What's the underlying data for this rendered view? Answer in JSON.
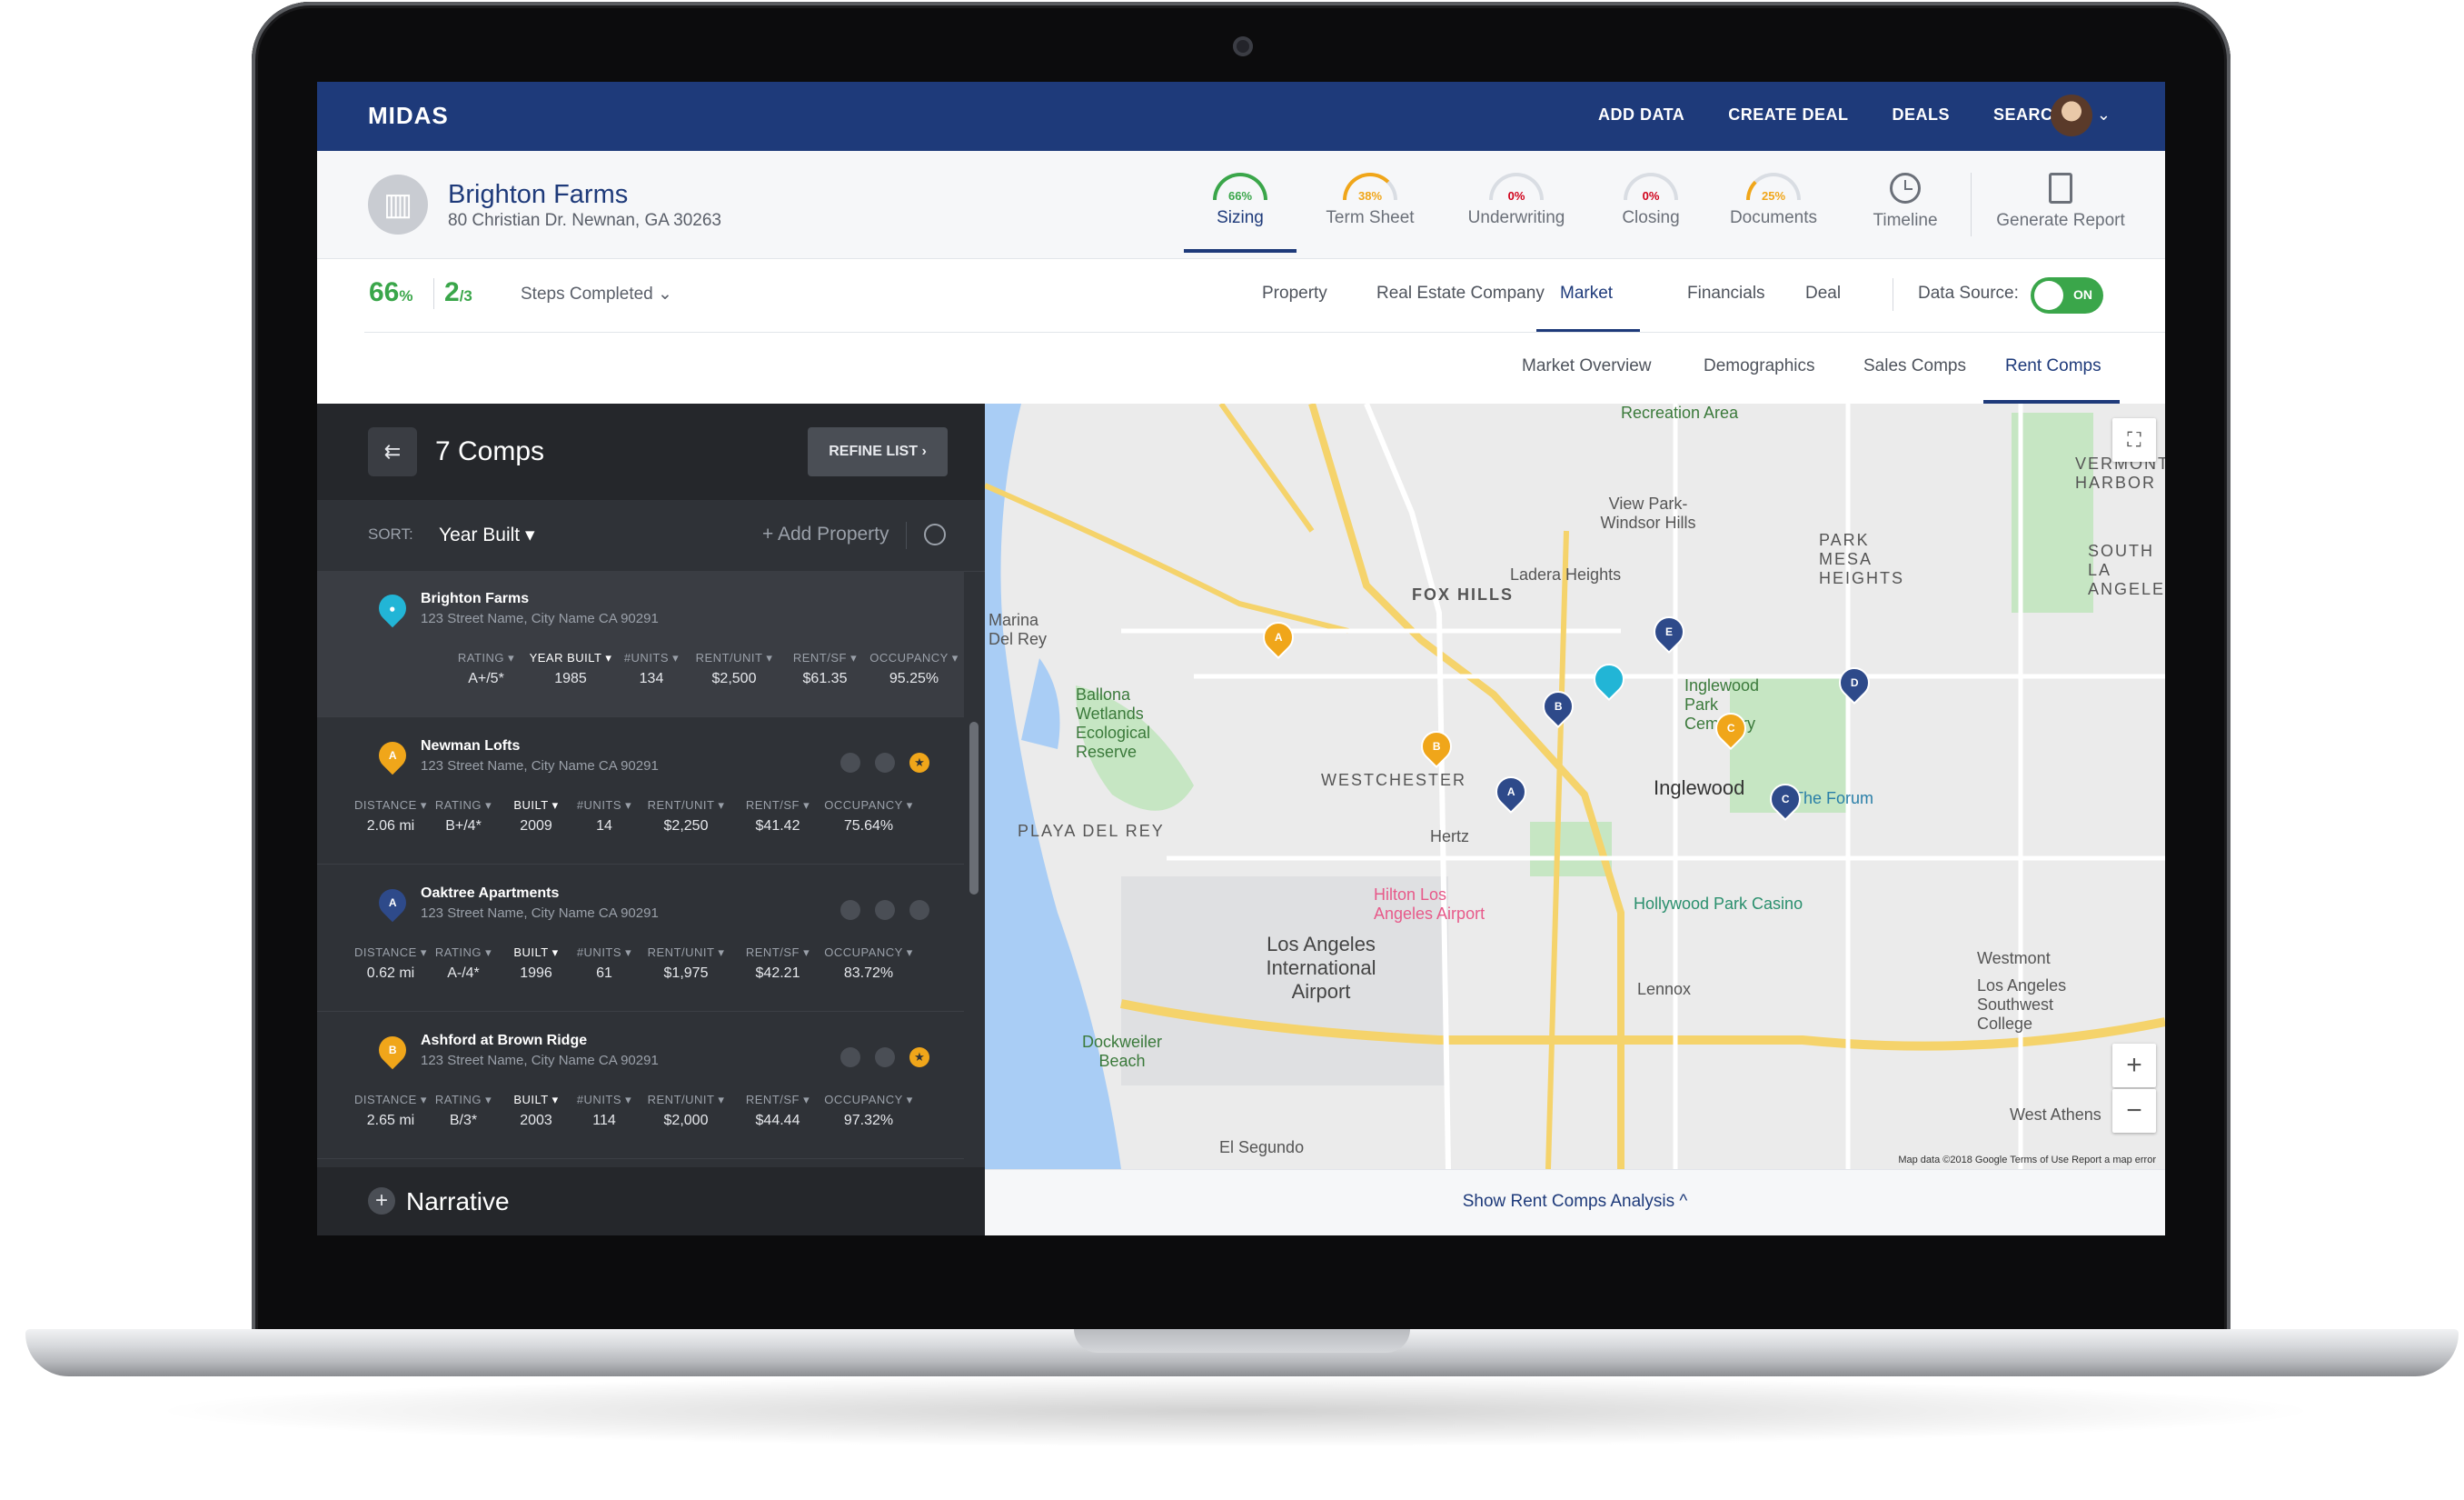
{
  "app": {
    "brand": "MIDAS",
    "nav": [
      "ADD DATA",
      "CREATE DEAL",
      "DEALS",
      "SEARCH"
    ]
  },
  "property": {
    "name": "Brighton Farms",
    "address": "80 Christian Dr. Newnan, GA 30263"
  },
  "workflow_steps": [
    {
      "label": "Sizing",
      "pct": "66%",
      "color": "#3aa64a",
      "progress": 0.66,
      "active": true
    },
    {
      "label": "Term Sheet",
      "pct": "38%",
      "color": "#f0a61a",
      "progress": 0.38
    },
    {
      "label": "Underwriting",
      "pct": "0%",
      "color": "#d0021b",
      "progress": 0.0
    },
    {
      "label": "Closing",
      "pct": "0%",
      "color": "#d0021b",
      "progress": 0.0
    },
    {
      "label": "Documents",
      "pct": "25%",
      "color": "#f0a61a",
      "progress": 0.25
    }
  ],
  "header_actions": {
    "timeline": "Timeline",
    "report": "Generate Report"
  },
  "progress": {
    "percent": "66",
    "percent_unit": "%",
    "done": "2",
    "total": "/3",
    "label": "Steps Completed"
  },
  "section_tabs": [
    "Property",
    "Real Estate Company",
    "Market",
    "Financials",
    "Deal"
  ],
  "active_section": "Market",
  "data_source": {
    "label": "Data Source:",
    "state": "ON"
  },
  "sub_tabs": [
    "Market Overview",
    "Demographics",
    "Sales Comps",
    "Rent Comps"
  ],
  "active_sub_tab": "Rent Comps",
  "comps_panel": {
    "title": "7 Comps",
    "refine": "REFINE LIST ›",
    "sort_label": "SORT:",
    "sort_value": "Year Built ▾",
    "add_property": "+ Add Property",
    "narrative": "Narrative"
  },
  "subject": {
    "name": "Brighton Farms",
    "address": "123 Street Name, City Name CA 90291",
    "headers": [
      "RATING ▾",
      "YEAR BUILT ▾",
      "#UNITS ▾",
      "RENT/UNIT ▾",
      "RENT/SF ▾",
      "OCCUPANCY ▾"
    ],
    "values": [
      "A+/5*",
      "1985",
      "134",
      "$2,500",
      "$61.35",
      "95.25%"
    ]
  },
  "comp_headers": [
    "DISTANCE ▾",
    "RATING ▾",
    "BUILT ▾",
    "#UNITS ▾",
    "RENT/UNIT ▾",
    "RENT/SF ▾",
    "OCCUPANCY ▾"
  ],
  "comps": [
    {
      "letter": "A",
      "pin_color": "#f0a61a",
      "name": "Newman Lofts",
      "address": "123 Street Name, City Name CA 90291",
      "values": [
        "2.06 mi",
        "B+/4*",
        "2009",
        "14",
        "$2,250",
        "$41.42",
        "75.64%"
      ],
      "starred": true
    },
    {
      "letter": "A",
      "pin_color": "#2e4a8a",
      "name": "Oaktree Apartments",
      "address": "123 Street Name, City Name CA 90291",
      "values": [
        "0.62 mi",
        "A-/4*",
        "1996",
        "61",
        "$1,975",
        "$42.21",
        "83.72%"
      ],
      "starred": false
    },
    {
      "letter": "B",
      "pin_color": "#f0a61a",
      "name": "Ashford at Brown Ridge",
      "address": "123 Street Name, City Name CA 90291",
      "values": [
        "2.65 mi",
        "B/3*",
        "2003",
        "114",
        "$2,000",
        "$44.44",
        "97.32%"
      ],
      "starred": true
    }
  ],
  "map": {
    "labels": [
      "FOX HILLS",
      "Ladera Heights",
      "View Park-Windsor Hills",
      "PARK MESA HEIGHTS",
      "Marina Del Rey",
      "Ballona Wetlands Ecological Reserve",
      "WESTCHESTER",
      "PLAYA DEL REY",
      "Inglewood",
      "Inglewood Park Cemetery",
      "The Forum",
      "Hollywood Park Casino",
      "Hilton Los Angeles Airport",
      "Hertz",
      "Los Angeles International Airport",
      "Lennox",
      "Westmont",
      "Los Angeles Southwest College",
      "Dockweiler Beach",
      "El Segundo",
      "West Athens",
      "Recreation Area",
      "VERMONT HARBOR",
      "SOUTH LA ANGELES"
    ],
    "pins": [
      {
        "letter": "A",
        "color": "#f0a61a"
      },
      {
        "letter": "E",
        "color": "#2e4a8a"
      },
      {
        "letter": "",
        "color": "#22b5d6"
      },
      {
        "letter": "B",
        "color": "#2e4a8a"
      },
      {
        "letter": "D",
        "color": "#2e4a8a"
      },
      {
        "letter": "C",
        "color": "#f0a61a"
      },
      {
        "letter": "B",
        "color": "#f0a61a"
      },
      {
        "letter": "A",
        "color": "#2e4a8a"
      },
      {
        "letter": "C",
        "color": "#2e4a8a"
      }
    ],
    "attribution": "Map data ©2018 Google   Terms of Use   Report a map error",
    "show_analysis": "Show Rent Comps Analysis ^"
  }
}
